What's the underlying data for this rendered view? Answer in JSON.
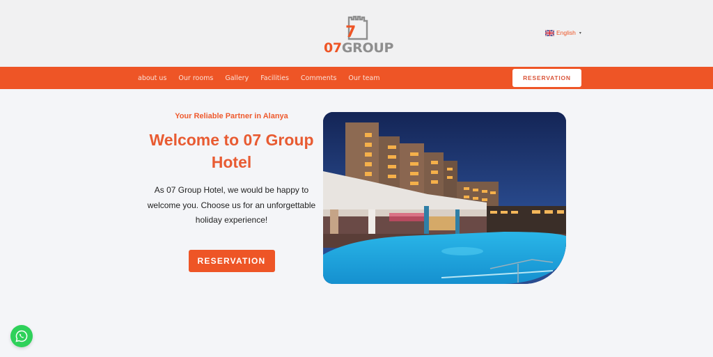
{
  "header": {
    "logo": {
      "number": "07",
      "word": "GROUP",
      "icon": "castle-tower-icon"
    },
    "language": {
      "flag": "uk-flag-icon",
      "label": "English",
      "caret": "▾"
    }
  },
  "nav": {
    "items": [
      {
        "label": "about us"
      },
      {
        "label": "Our rooms"
      },
      {
        "label": "Gallery"
      },
      {
        "label": "Facilities"
      },
      {
        "label": "Comments"
      },
      {
        "label": "Our team"
      }
    ],
    "reservation_label": "RESERVATION"
  },
  "hero": {
    "tagline": "Your Reliable Partner in Alanya",
    "title": "Welcome to 07 Group Hotel",
    "description": "As 07 Group Hotel, we would be happy to welcome you. Choose us for an unforgettable holiday experience!",
    "reservation_label": "RESERVATION",
    "image": {
      "subject": "Hotel building with illuminated balconies and a blue swimming pool at dusk"
    }
  },
  "floating": {
    "whatsapp": "whatsapp-icon"
  },
  "colors": {
    "brand": "#ee5526",
    "background": "#f4f5f8",
    "header_bg": "#f1f1f2",
    "logo_gray": "#8e8e8e",
    "whatsapp": "#2ed15a"
  }
}
